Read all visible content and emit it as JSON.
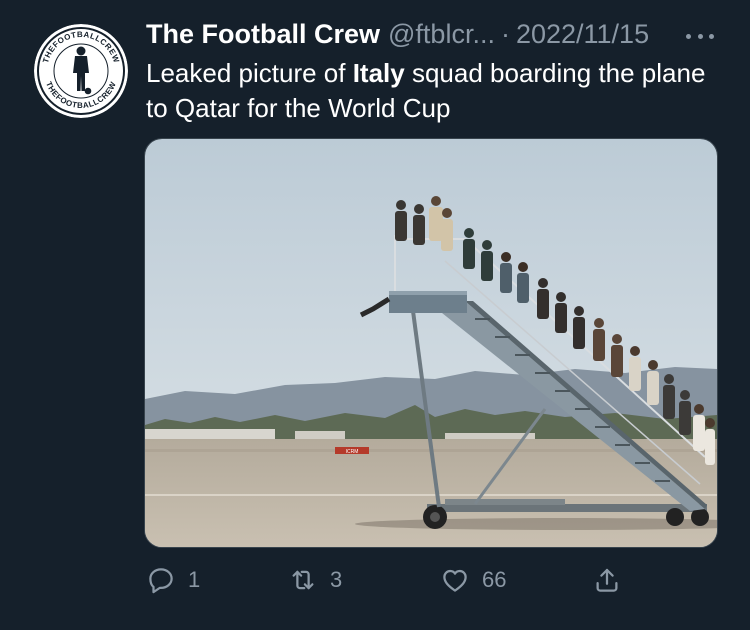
{
  "tweet": {
    "author": {
      "display_name": "The Football Crew",
      "handle": "@ftblcr...",
      "avatar_text_top": "THEFOOTBALLCREW",
      "avatar_text_bottom": "THEFOOTBALLCREW"
    },
    "separator": "·",
    "date": "2022/11/15",
    "text_before": "Leaked picture of ",
    "text_bold": "Italy",
    "text_after": " squad boarding the plane to Qatar for the World Cup",
    "media": {
      "sign_text": "ICRM"
    },
    "actions": {
      "reply_count": "1",
      "retweet_count": "3",
      "like_count": "66"
    }
  },
  "colors": {
    "background": "#15202b",
    "text_primary": "#ffffff",
    "text_secondary": "#8b98a5",
    "border": "#38444d"
  },
  "icons": [
    "more-icon",
    "reply-icon",
    "retweet-icon",
    "like-icon",
    "share-icon"
  ]
}
